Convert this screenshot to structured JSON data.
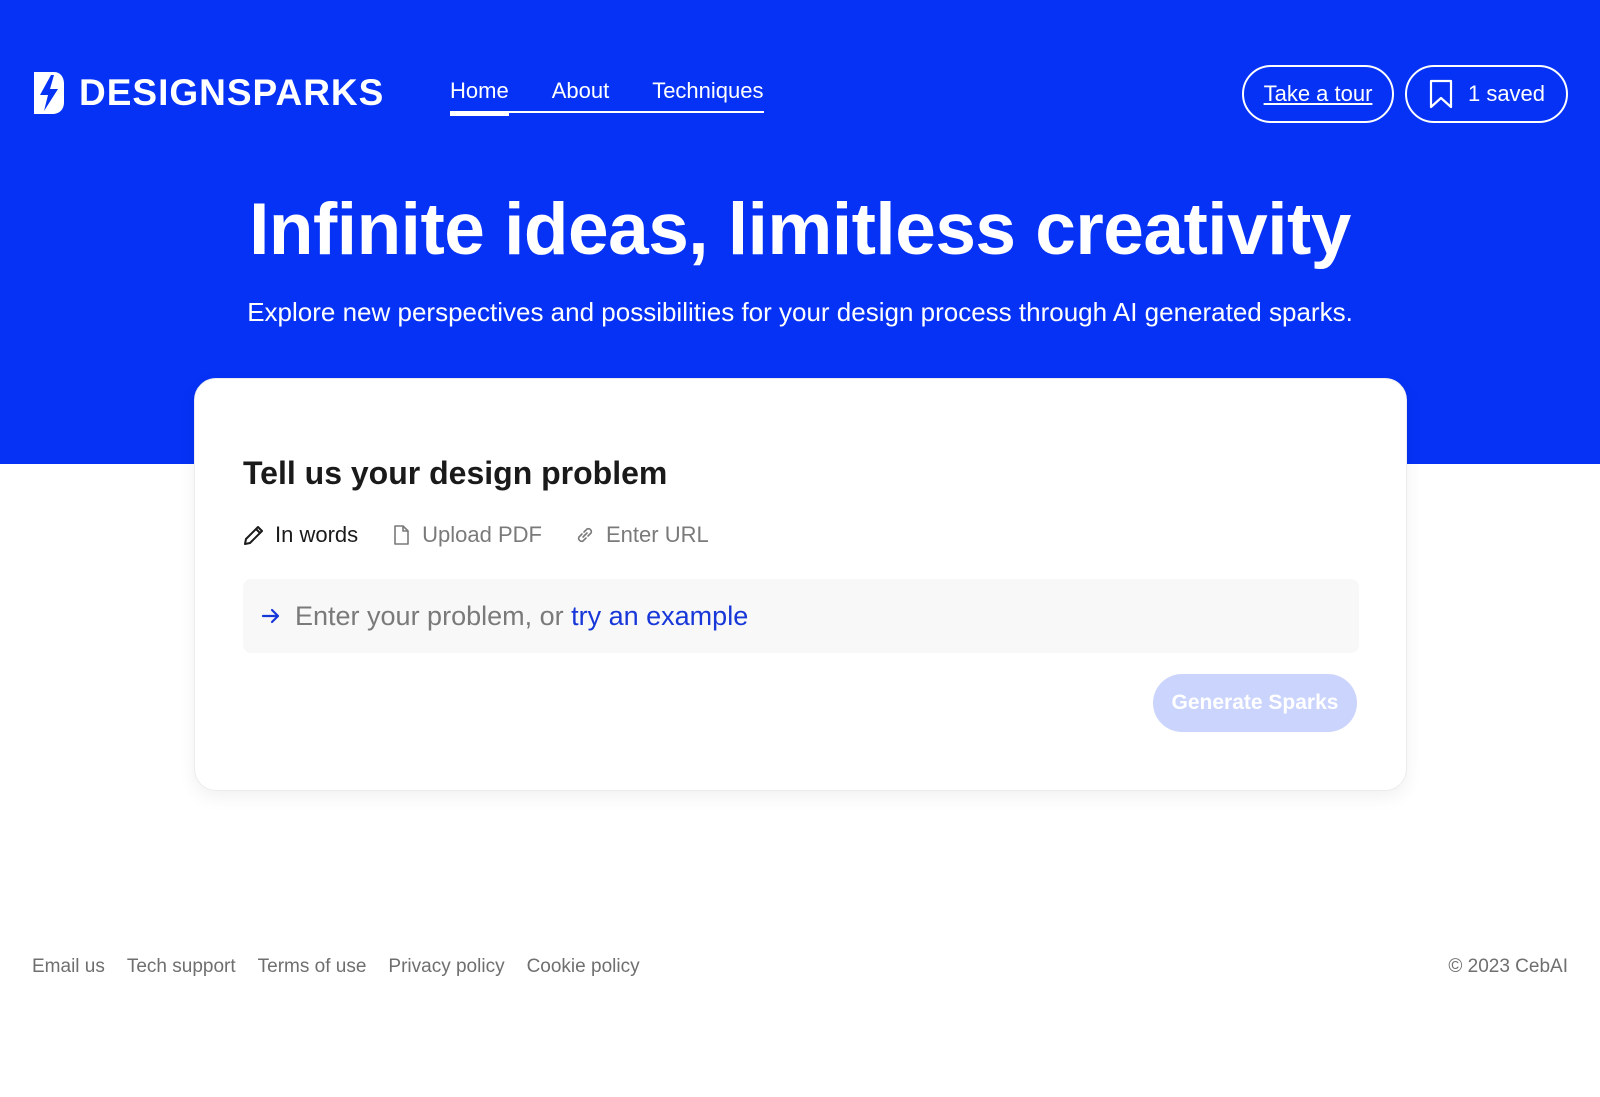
{
  "brand": {
    "name": "DESIGNSPARKS",
    "logo_icon": "lightning-bolt-icon",
    "primary_color": "#0532f5"
  },
  "nav": {
    "items": [
      {
        "label": "Home",
        "active": true
      },
      {
        "label": "About",
        "active": false
      },
      {
        "label": "Techniques",
        "active": false
      }
    ]
  },
  "header_actions": {
    "tour_label": "Take a tour",
    "saved_label": "1 saved",
    "saved_icon": "bookmark-icon"
  },
  "hero": {
    "title": "Infinite ideas, limitless creativity",
    "subtitle": "Explore new perspectives and possibilities for your design process through AI generated sparks."
  },
  "problem_card": {
    "title": "Tell us your design problem",
    "modes": [
      {
        "label": "In words",
        "icon": "pencil-icon",
        "active": true
      },
      {
        "label": "Upload PDF",
        "icon": "document-icon",
        "active": false
      },
      {
        "label": "Enter URL",
        "icon": "link-icon",
        "active": false
      }
    ],
    "input_placeholder": "Enter your problem, or ",
    "example_link": "try an example",
    "input_icon": "arrow-right-icon",
    "generate_label": "Generate Sparks",
    "generate_disabled_color": "#cbd4fc",
    "link_color": "#1737d9"
  },
  "footer": {
    "links": [
      "Email us",
      "Tech support",
      "Terms of use",
      "Privacy policy",
      "Cookie policy"
    ],
    "copyright": "© 2023 CebAI"
  }
}
